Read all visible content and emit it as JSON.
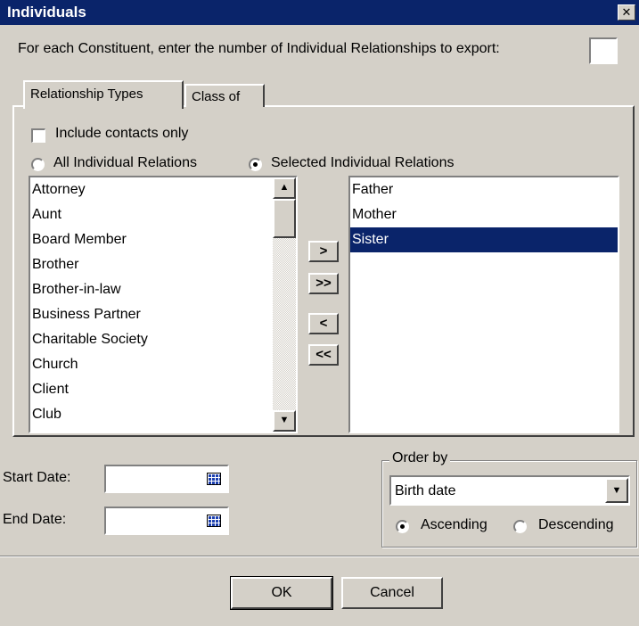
{
  "dialog": {
    "title": "Individuals"
  },
  "count_prompt": {
    "label": "For each Constituent, enter the number of Individual Relationships to export:",
    "value": ""
  },
  "tabs": [
    {
      "label": "Relationship Types"
    },
    {
      "label": "Class of"
    }
  ],
  "include_contacts": {
    "label": "Include contacts only",
    "checked": false
  },
  "relation_mode": {
    "all_label": "All Individual Relations",
    "selected_label": "Selected Individual Relations",
    "selected": "selected"
  },
  "available_list": {
    "items": [
      "Attorney",
      "Aunt",
      "Board Member",
      "Brother",
      "Brother-in-law",
      "Business Partner",
      "Charitable Society",
      "Church",
      "Client",
      "Club"
    ]
  },
  "move_buttons": {
    "add_one": ">",
    "add_all": ">>",
    "remove_one": "<",
    "remove_all": "<<"
  },
  "selected_list": {
    "items": [
      "Father",
      "Mother",
      "Sister"
    ],
    "highlighted": "Sister"
  },
  "start_date": {
    "label": "Start Date:",
    "value": ""
  },
  "end_date": {
    "label": "End Date:",
    "value": ""
  },
  "order_by": {
    "group_label": "Order by",
    "value": "Birth date",
    "ascending_label": "Ascending",
    "descending_label": "Descending",
    "direction": "ascending"
  },
  "footer": {
    "ok_label": "OK",
    "cancel_label": "Cancel"
  }
}
